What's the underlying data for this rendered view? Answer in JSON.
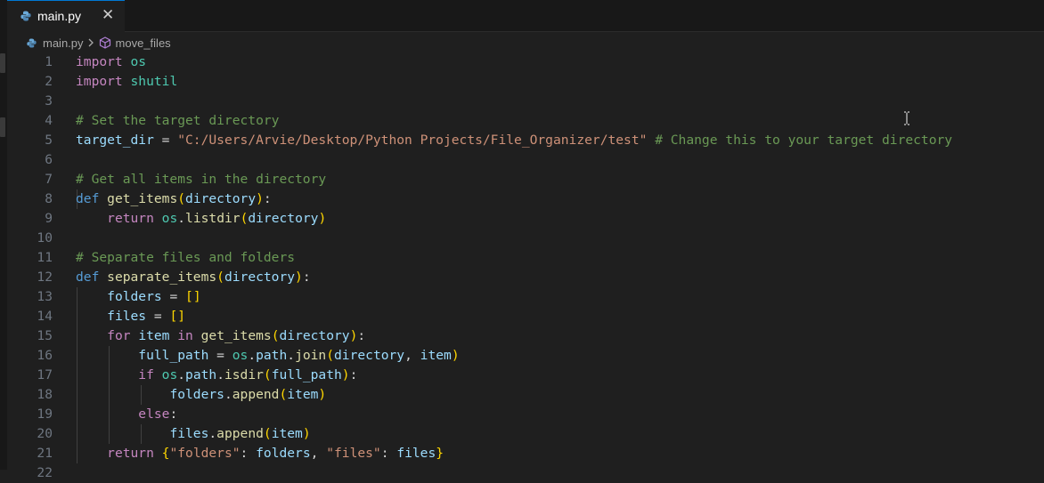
{
  "tab": {
    "filename": "main.py"
  },
  "breadcrumb": {
    "file": "main.py",
    "symbol": "move_files"
  },
  "colors": {
    "accent": "#0078d4",
    "editor_bg": "#1f1f1f"
  },
  "icons": [
    "python-file-icon",
    "close-icon",
    "chevron-right-icon",
    "cube-symbol-icon",
    "text-cursor-icon"
  ],
  "editor": {
    "line_numbers": [
      "1",
      "2",
      "3",
      "4",
      "5",
      "6",
      "7",
      "8",
      "9",
      "10",
      "11",
      "12",
      "13",
      "14",
      "15",
      "16",
      "17",
      "18",
      "19",
      "20",
      "21",
      "22"
    ],
    "lines": [
      [
        [
          "kw",
          "import "
        ],
        [
          "mod",
          "os"
        ]
      ],
      [
        [
          "kw",
          "import "
        ],
        [
          "mod",
          "shutil"
        ]
      ],
      [],
      [
        [
          "cm",
          "# Set the target directory"
        ]
      ],
      [
        [
          "var",
          "target_dir"
        ],
        [
          "plain",
          " = "
        ],
        [
          "str",
          "\"C:/Users/Arvie/Desktop/Python Projects/File_Organizer/test\""
        ],
        [
          "plain",
          " "
        ],
        [
          "cm",
          "# Change this to your target directory"
        ]
      ],
      [],
      [
        [
          "cm",
          "# Get all items in the directory"
        ]
      ],
      [
        [
          "def",
          "def "
        ],
        [
          "fn",
          "get_items"
        ],
        [
          "p1",
          "("
        ],
        [
          "var",
          "directory"
        ],
        [
          "p1",
          ")"
        ],
        [
          "plain",
          ":"
        ]
      ],
      [
        [
          "plain",
          "    "
        ],
        [
          "kw",
          "return "
        ],
        [
          "mod",
          "os"
        ],
        [
          "plain",
          "."
        ],
        [
          "fn",
          "listdir"
        ],
        [
          "p1",
          "("
        ],
        [
          "var",
          "directory"
        ],
        [
          "p1",
          ")"
        ]
      ],
      [],
      [
        [
          "cm",
          "# Separate files and folders"
        ]
      ],
      [
        [
          "def",
          "def "
        ],
        [
          "fn",
          "separate_items"
        ],
        [
          "p1",
          "("
        ],
        [
          "var",
          "directory"
        ],
        [
          "p1",
          ")"
        ],
        [
          "plain",
          ":"
        ]
      ],
      [
        [
          "plain",
          "    "
        ],
        [
          "var",
          "folders"
        ],
        [
          "plain",
          " = "
        ],
        [
          "p1",
          "[]"
        ]
      ],
      [
        [
          "plain",
          "    "
        ],
        [
          "var",
          "files"
        ],
        [
          "plain",
          " = "
        ],
        [
          "p1",
          "[]"
        ]
      ],
      [
        [
          "plain",
          "    "
        ],
        [
          "kw",
          "for "
        ],
        [
          "var",
          "item"
        ],
        [
          "kw",
          " in "
        ],
        [
          "fn",
          "get_items"
        ],
        [
          "p1",
          "("
        ],
        [
          "var",
          "directory"
        ],
        [
          "p1",
          ")"
        ],
        [
          "plain",
          ":"
        ]
      ],
      [
        [
          "plain",
          "        "
        ],
        [
          "var",
          "full_path"
        ],
        [
          "plain",
          " = "
        ],
        [
          "mod",
          "os"
        ],
        [
          "plain",
          "."
        ],
        [
          "var",
          "path"
        ],
        [
          "plain",
          "."
        ],
        [
          "fn",
          "join"
        ],
        [
          "p1",
          "("
        ],
        [
          "var",
          "directory"
        ],
        [
          "plain",
          ", "
        ],
        [
          "var",
          "item"
        ],
        [
          "p1",
          ")"
        ]
      ],
      [
        [
          "plain",
          "        "
        ],
        [
          "kw",
          "if "
        ],
        [
          "mod",
          "os"
        ],
        [
          "plain",
          "."
        ],
        [
          "var",
          "path"
        ],
        [
          "plain",
          "."
        ],
        [
          "fn",
          "isdir"
        ],
        [
          "p1",
          "("
        ],
        [
          "var",
          "full_path"
        ],
        [
          "p1",
          ")"
        ],
        [
          "plain",
          ":"
        ]
      ],
      [
        [
          "plain",
          "            "
        ],
        [
          "var",
          "folders"
        ],
        [
          "plain",
          "."
        ],
        [
          "fn",
          "append"
        ],
        [
          "p1",
          "("
        ],
        [
          "var",
          "item"
        ],
        [
          "p1",
          ")"
        ]
      ],
      [
        [
          "plain",
          "        "
        ],
        [
          "kw",
          "else"
        ],
        [
          "plain",
          ":"
        ]
      ],
      [
        [
          "plain",
          "            "
        ],
        [
          "var",
          "files"
        ],
        [
          "plain",
          "."
        ],
        [
          "fn",
          "append"
        ],
        [
          "p1",
          "("
        ],
        [
          "var",
          "item"
        ],
        [
          "p1",
          ")"
        ]
      ],
      [
        [
          "plain",
          "    "
        ],
        [
          "kw",
          "return "
        ],
        [
          "p1",
          "{"
        ],
        [
          "str",
          "\"folders\""
        ],
        [
          "plain",
          ": "
        ],
        [
          "var",
          "folders"
        ],
        [
          "plain",
          ", "
        ],
        [
          "str",
          "\"files\""
        ],
        [
          "plain",
          ": "
        ],
        [
          "var",
          "files"
        ],
        [
          "p1",
          "}"
        ]
      ],
      []
    ]
  }
}
